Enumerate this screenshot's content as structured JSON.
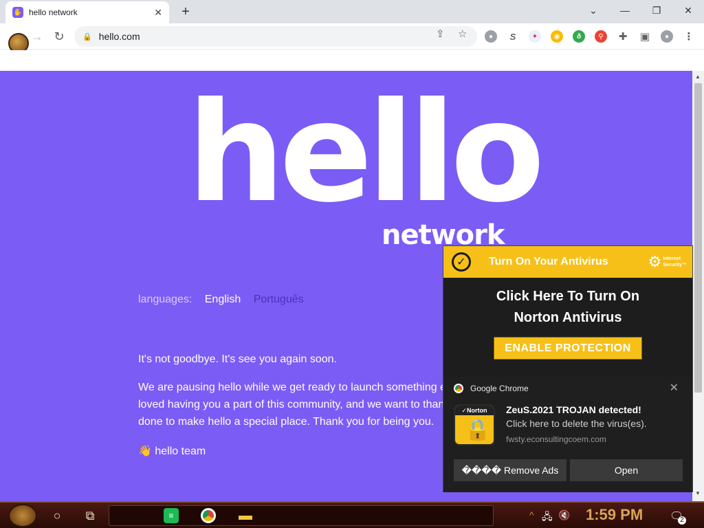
{
  "browser": {
    "tab_title": "hello network",
    "url": "hello.com"
  },
  "page": {
    "logo_main": "hello",
    "logo_sub": "network",
    "languages_label": "languages:",
    "language_en": "English",
    "language_pt": "Português",
    "paragraph1": "It's not goodbye. It's see you again soon.",
    "paragraph2": "We are pausing hello while we get ready to launch something e loved having you a part of this community, and we want to than done to make hello a special place. Thank you for being you.",
    "signoff_emoji": "👋",
    "signoff": "hello team",
    "bg_color": "#7b5cf5"
  },
  "popup": {
    "header_title": "Turn On Your Antivirus",
    "badge_line1": "Internet",
    "badge_line2": "Security™",
    "headline_line1": "Click Here To Turn On",
    "headline_line2": "Norton Antivirus",
    "enable_button": "ENABLE PROTECTION",
    "accent_color": "#f6c018"
  },
  "notification": {
    "source": "Google Chrome",
    "brand": "✓Norton",
    "title": "ZeuS.2021 TROJAN detected!",
    "message": "Click here to delete the virus(es).",
    "domain": "fwsty.econsultingcoem.com",
    "remove_ads_button": "���� Remove Ads",
    "open_button": "Open"
  },
  "taskbar": {
    "clock": "1:59 PM",
    "notification_count": "2"
  }
}
